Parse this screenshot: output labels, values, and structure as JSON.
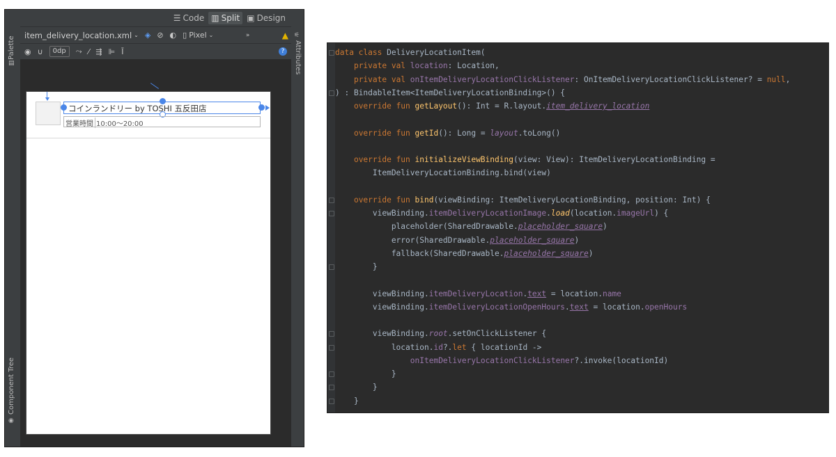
{
  "editor": {
    "modes": [
      "Code",
      "Split",
      "Design"
    ],
    "active_mode": "Split",
    "file_name": "item_delivery_location.xml",
    "device": "Pixel",
    "margin_value": "0dp",
    "left_panels": {
      "palette": "Palette",
      "component_tree": "Component Tree"
    },
    "right_panels": {
      "attributes": "Attributes"
    },
    "warning_icon": "warning-icon",
    "help_icon": "help-icon"
  },
  "preview": {
    "store_name": "コインランドリー by TOSHI 五反田店",
    "hours_label": "営業時間",
    "hours_value": "10:00〜20:00"
  },
  "code": {
    "lines": [
      [
        [
          "kw",
          "data class "
        ],
        [
          "p",
          "DeliveryLocationItem("
        ]
      ],
      [
        [
          "p",
          "    "
        ],
        [
          "kw",
          "private val "
        ],
        [
          "prop",
          "location"
        ],
        [
          "p",
          ": Location,"
        ]
      ],
      [
        [
          "p",
          "    "
        ],
        [
          "kw",
          "private val "
        ],
        [
          "prop",
          "onItemDeliveryLocationClickListener"
        ],
        [
          "p",
          ": OnItemDeliveryLocationClickListener? = "
        ],
        [
          "kw",
          "null"
        ],
        [
          "p",
          ","
        ]
      ],
      [
        [
          "p",
          ") : BindableItem<ItemDeliveryLocationBinding>() {"
        ]
      ],
      [
        [
          "p",
          "    "
        ],
        [
          "kw",
          "override fun "
        ],
        [
          "fn",
          "getLayout"
        ],
        [
          "p",
          "(): Int = R.layout."
        ],
        [
          "propiu",
          "item_delivery_location"
        ]
      ],
      [
        [
          "p",
          ""
        ]
      ],
      [
        [
          "p",
          "    "
        ],
        [
          "kw",
          "override fun "
        ],
        [
          "fn",
          "getId"
        ],
        [
          "p",
          "(): Long = "
        ],
        [
          "propi",
          "layout"
        ],
        [
          "p",
          ".toLong()"
        ]
      ],
      [
        [
          "p",
          ""
        ]
      ],
      [
        [
          "p",
          "    "
        ],
        [
          "kw",
          "override fun "
        ],
        [
          "fn",
          "initializeViewBinding"
        ],
        [
          "p",
          "(view: View): ItemDeliveryLocationBinding ="
        ]
      ],
      [
        [
          "p",
          "        ItemDeliveryLocationBinding.bind(view)"
        ]
      ],
      [
        [
          "p",
          ""
        ]
      ],
      [
        [
          "p",
          "    "
        ],
        [
          "kw",
          "override fun "
        ],
        [
          "fn",
          "bind"
        ],
        [
          "p",
          "(viewBinding: ItemDeliveryLocationBinding, position: Int) {"
        ]
      ],
      [
        [
          "p",
          "        viewBinding."
        ],
        [
          "prop",
          "itemDeliveryLocationImage"
        ],
        [
          "p",
          "."
        ],
        [
          "fni",
          "load"
        ],
        [
          "p",
          "(location."
        ],
        [
          "prop",
          "imageUrl"
        ],
        [
          "p",
          ") {"
        ]
      ],
      [
        [
          "p",
          "            placeholder(SharedDrawable."
        ],
        [
          "propiu",
          "placeholder_square"
        ],
        [
          "p",
          ")"
        ]
      ],
      [
        [
          "p",
          "            error(SharedDrawable."
        ],
        [
          "propiu",
          "placeholder_square"
        ],
        [
          "p",
          ")"
        ]
      ],
      [
        [
          "p",
          "            fallback(SharedDrawable."
        ],
        [
          "propiu",
          "placeholder_square"
        ],
        [
          "p",
          ")"
        ]
      ],
      [
        [
          "p",
          "        }"
        ]
      ],
      [
        [
          "p",
          ""
        ]
      ],
      [
        [
          "p",
          "        viewBinding."
        ],
        [
          "prop",
          "itemDeliveryLocation"
        ],
        [
          "p",
          "."
        ],
        [
          "propu",
          "text"
        ],
        [
          "p",
          " = location."
        ],
        [
          "prop",
          "name"
        ]
      ],
      [
        [
          "p",
          "        viewBinding."
        ],
        [
          "prop",
          "itemDeliveryLocationOpenHours"
        ],
        [
          "p",
          "."
        ],
        [
          "propu",
          "text"
        ],
        [
          "p",
          " = location."
        ],
        [
          "prop",
          "openHours"
        ]
      ],
      [
        [
          "p",
          ""
        ]
      ],
      [
        [
          "p",
          "        viewBinding."
        ],
        [
          "propi",
          "root"
        ],
        [
          "p",
          ".setOnClickListener {"
        ]
      ],
      [
        [
          "p",
          "            location."
        ],
        [
          "prop",
          "id"
        ],
        [
          "p",
          "?."
        ],
        [
          "kw",
          "let"
        ],
        [
          "p",
          " { locationId ->"
        ]
      ],
      [
        [
          "p",
          "                "
        ],
        [
          "prop",
          "onItemDeliveryLocationClickListener"
        ],
        [
          "p",
          "?.invoke(locationId)"
        ]
      ],
      [
        [
          "p",
          "            }"
        ]
      ],
      [
        [
          "p",
          "        }"
        ]
      ],
      [
        [
          "p",
          "    }"
        ]
      ]
    ]
  },
  "colors": {
    "keyword": "#cc7832",
    "function": "#ffc66d",
    "property": "#9876aa",
    "plain": "#a9b7c6",
    "selection_blue": "#4a86e8"
  }
}
